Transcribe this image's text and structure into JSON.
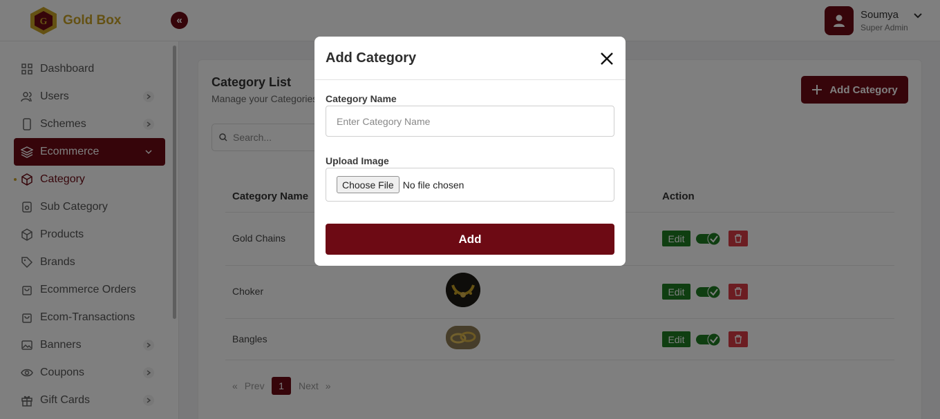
{
  "header": {
    "brand": "Gold Box",
    "collapse_icon": "double-chevron-left-icon",
    "user": {
      "name": "Soumya",
      "role": "Super Admin"
    }
  },
  "sidebar": {
    "items": [
      {
        "label": "Dashboard",
        "icon": "grid-icon",
        "has_chevron": false
      },
      {
        "label": "Users",
        "icon": "users-icon",
        "has_chevron": true
      },
      {
        "label": "Schemes",
        "icon": "mobile-icon",
        "has_chevron": true
      },
      {
        "label": "Ecommerce",
        "icon": "layers-icon",
        "has_chevron": true,
        "active": true
      },
      {
        "label": "Category",
        "icon": "cube-icon",
        "current": true
      },
      {
        "label": "Sub Category",
        "icon": "box-icon"
      },
      {
        "label": "Products",
        "icon": "package-icon"
      },
      {
        "label": "Brands",
        "icon": "tag-icon"
      },
      {
        "label": "Ecommerce Orders",
        "icon": "shopping-bag-icon"
      },
      {
        "label": "Ecom-Transactions",
        "icon": "shopping-bag-icon"
      },
      {
        "label": "Banners",
        "icon": "image-icon",
        "has_chevron": true
      },
      {
        "label": "Coupons",
        "icon": "eye-icon",
        "has_chevron": true
      },
      {
        "label": "Gift Cards",
        "icon": "gift-icon",
        "has_chevron": true
      }
    ]
  },
  "main": {
    "title": "Category List",
    "subtitle": "Manage your Categories",
    "add_button": "Add Category",
    "search_placeholder": "Search...",
    "table": {
      "headers": [
        "Category Name",
        "Action"
      ],
      "rows": [
        {
          "name": "Gold Chains",
          "edit": "Edit",
          "active": true
        },
        {
          "name": "Choker",
          "edit": "Edit",
          "active": true
        },
        {
          "name": "Bangles",
          "edit": "Edit",
          "active": true
        }
      ]
    },
    "pagination": {
      "prev": "Prev",
      "next": "Next",
      "current": "1"
    }
  },
  "modal": {
    "title": "Add Category",
    "name_label": "Category Name",
    "name_placeholder": "Enter Category Name",
    "upload_label": "Upload Image",
    "file_button": "Choose File",
    "file_status": "No file chosen",
    "submit": "Add"
  },
  "colors": {
    "primary": "#6d0a14",
    "gold": "#c9a227",
    "success": "#1e7d22",
    "danger": "#d93a44"
  }
}
